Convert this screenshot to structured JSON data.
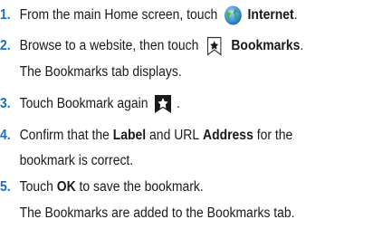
{
  "steps": [
    {
      "num": "1.",
      "pre": "From the main Home screen, touch",
      "bold": "Internet",
      "post": ".",
      "icon": "internet-globe-icon"
    },
    {
      "num": "2.",
      "pre": "Browse to a website, then touch",
      "bold": "Bookmarks",
      "post": ".",
      "icon": "bookmarks-star-icon",
      "sub": "The Bookmarks tab displays."
    },
    {
      "num": "3.",
      "pre": "Touch Bookmark again",
      "post": ".",
      "icon": "bookmark-star-icon"
    },
    {
      "num": "4.",
      "pre": "Confirm that the",
      "bold1": "Label",
      "mid": "and URL",
      "bold2": "Address",
      "post": "for the",
      "cont": "bookmark is correct."
    },
    {
      "num": "5.",
      "pre": "Touch",
      "bold": "OK",
      "post": "to save the bookmark.",
      "sub": "The Bookmarks are added to the Bookmarks tab."
    }
  ],
  "colors": {
    "step_number": "#1a6ec8",
    "text": "#1a1a1a"
  }
}
